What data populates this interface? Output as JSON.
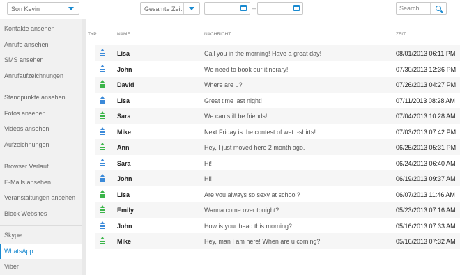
{
  "toolbar": {
    "device_select": "Son Kevin",
    "time_select": "Gesamte Zeit",
    "date_from": "",
    "date_to": "",
    "date_separator": "–",
    "search_placeholder": "Search"
  },
  "sidebar": {
    "groups": [
      [
        "Kontakte ansehen",
        "Anrufe ansehen",
        "SMS ansehen",
        "Anrufaufzeichnungen"
      ],
      [
        "Standpunkte ansehen",
        "Fotos ansehen",
        "Videos ansehen",
        "Aufzeichnungen"
      ],
      [
        "Browser Verlauf",
        "E-Mails ansehen",
        "Veranstaltungen ansehen",
        "Block Websites"
      ],
      [
        "Skype",
        "WhatsApp",
        "Viber"
      ]
    ],
    "active": "WhatsApp"
  },
  "table": {
    "columns": {
      "type": "TYP",
      "name": "NAME",
      "message": "NACHRICHT",
      "time": "ZEIT"
    },
    "rows": [
      {
        "type": "outgoing",
        "name": "Lisa",
        "message": "Call you in the morning! Have a great day!",
        "time": "08/01/2013 06:11 PM"
      },
      {
        "type": "outgoing",
        "name": "John",
        "message": "We need to book our itinerary!",
        "time": "07/30/2013 12:36 PM"
      },
      {
        "type": "incoming",
        "name": "David",
        "message": "Where are u?",
        "time": "07/26/2013 04:27 PM"
      },
      {
        "type": "outgoing",
        "name": "Lisa",
        "message": "Great time last night!",
        "time": "07/11/2013 08:28 AM"
      },
      {
        "type": "incoming",
        "name": "Sara",
        "message": "We can still be friends!",
        "time": "07/04/2013 10:28 AM"
      },
      {
        "type": "outgoing",
        "name": "Mike",
        "message": "Next Friday is the contest of wet t-shirts!",
        "time": "07/03/2013 07:42 PM"
      },
      {
        "type": "incoming",
        "name": "Ann",
        "message": "Hey, I just moved here 2 month ago.",
        "time": "06/25/2013 05:31 PM"
      },
      {
        "type": "outgoing",
        "name": "Sara",
        "message": "Hi!",
        "time": "06/24/2013 06:40 AM"
      },
      {
        "type": "outgoing",
        "name": "John",
        "message": "Hi!",
        "time": "06/19/2013 09:37 AM"
      },
      {
        "type": "incoming",
        "name": "Lisa",
        "message": "Are you always so sexy at school?",
        "time": "06/07/2013 11:46 AM"
      },
      {
        "type": "incoming",
        "name": "Emily",
        "message": "Wanna come over tonight?",
        "time": "05/23/2013 07:16 AM"
      },
      {
        "type": "outgoing",
        "name": "John",
        "message": "How is your head this morning?",
        "time": "05/16/2013 07:33 AM"
      },
      {
        "type": "incoming",
        "name": "Mike",
        "message": "Hey, man I am here! When are u coming?",
        "time": "05/16/2013 07:32 AM"
      }
    ]
  },
  "icons": {
    "outgoing": "outgoing-message-icon",
    "incoming": "incoming-message-icon"
  },
  "colors": {
    "accent": "#1a8ad0",
    "outgoing": "#3b8ad9",
    "incoming": "#3bb54a"
  }
}
